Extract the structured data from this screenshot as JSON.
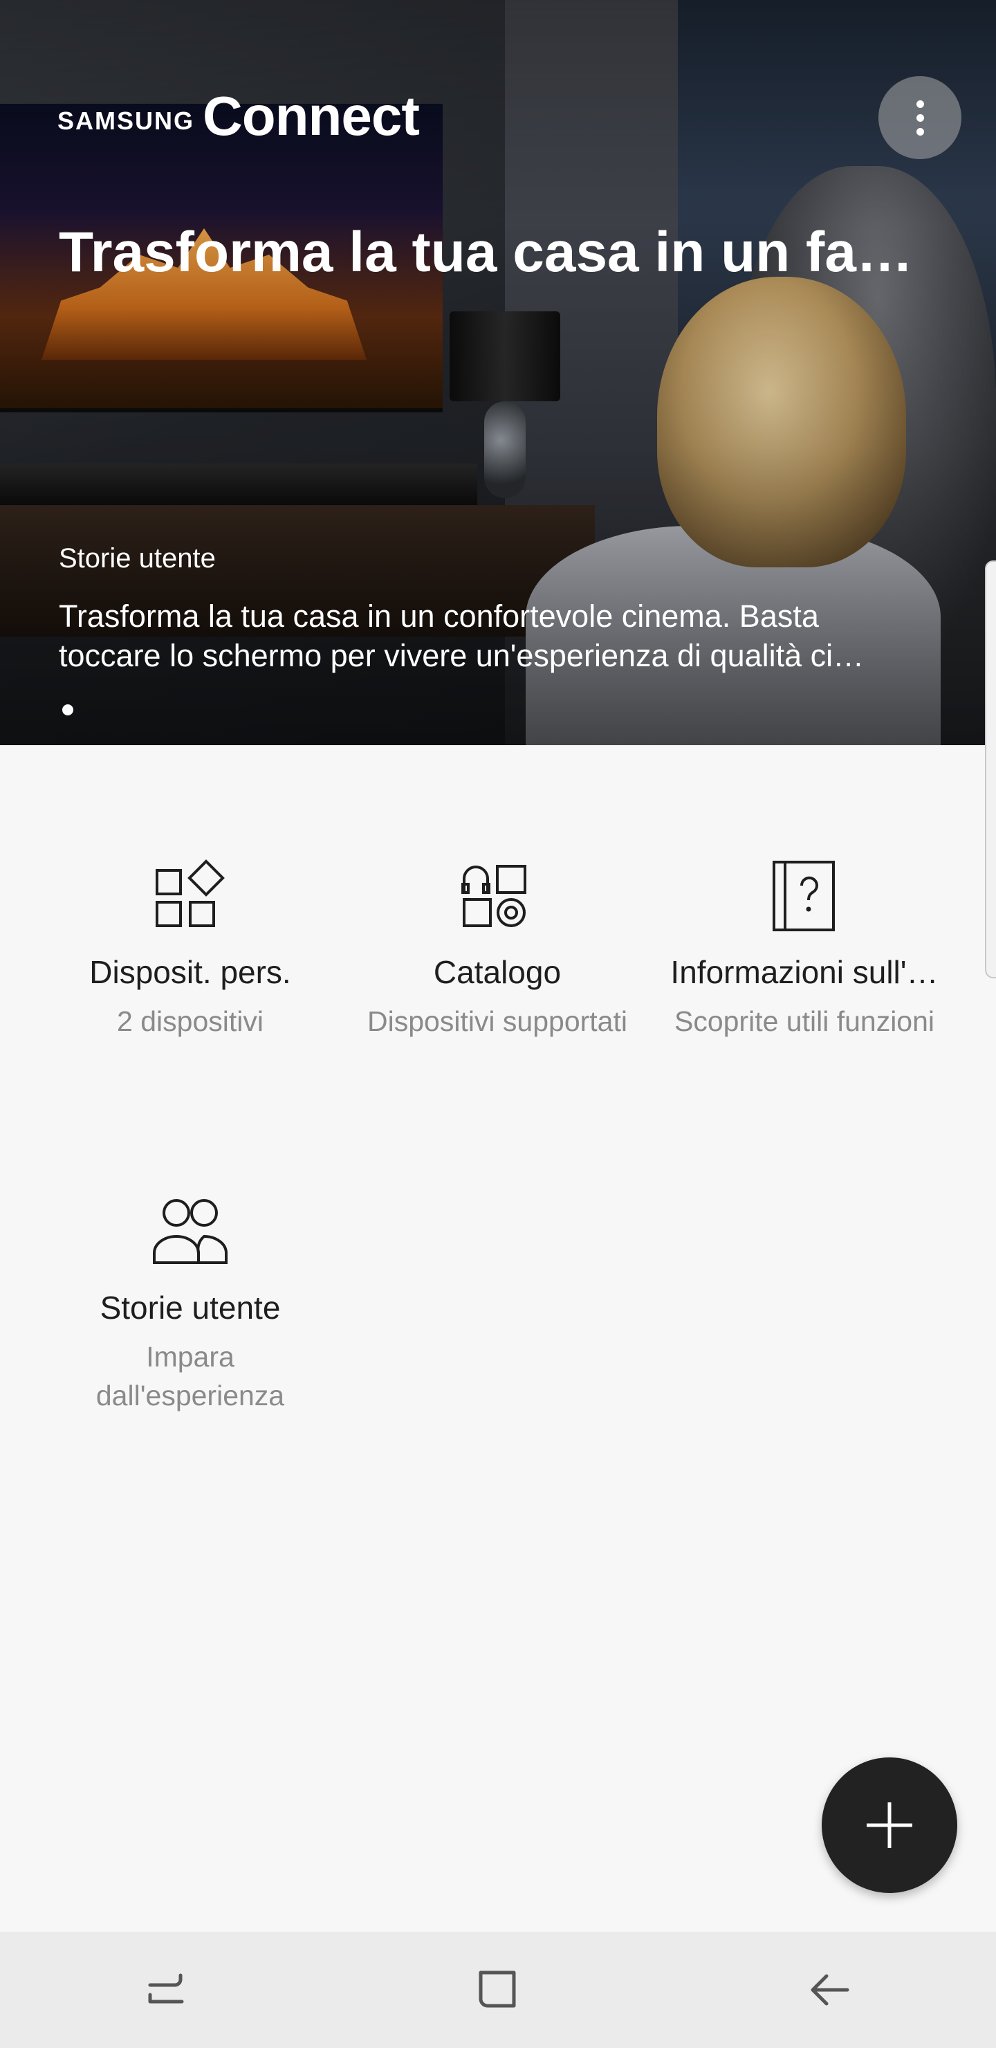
{
  "hero": {
    "brand_prefix": "SAMSUNG",
    "brand_name": "Connect",
    "title": "Trasforma la tua casa in un fa…",
    "category": "Storie utente",
    "description_line1": "Trasforma la tua casa in un confortevole cinema. Basta",
    "description_line2": "toccare lo schermo per vivere un'esperienza di qualità ci…"
  },
  "tiles": [
    {
      "icon": "devices-icon",
      "title": "Disposit. pers.",
      "subtitle": "2 dispositivi"
    },
    {
      "icon": "catalog-icon",
      "title": "Catalogo",
      "subtitle": "Dispositivi supportati"
    },
    {
      "icon": "help-book-icon",
      "title": "Informazioni sull'…",
      "subtitle": "Scoprite utili funzioni"
    },
    {
      "icon": "users-icon",
      "title": "Storie utente",
      "subtitle_line1": "Impara",
      "subtitle_line2": "dall'esperienza"
    }
  ],
  "fab": {
    "icon": "plus-icon"
  },
  "navbar": {
    "items": [
      "recents-icon",
      "home-icon",
      "back-icon"
    ]
  },
  "colors": {
    "fab_bg": "#222222",
    "background": "#f7f7f7",
    "navbar_bg": "#ebebeb",
    "subtitle": "#8a8a8a"
  }
}
